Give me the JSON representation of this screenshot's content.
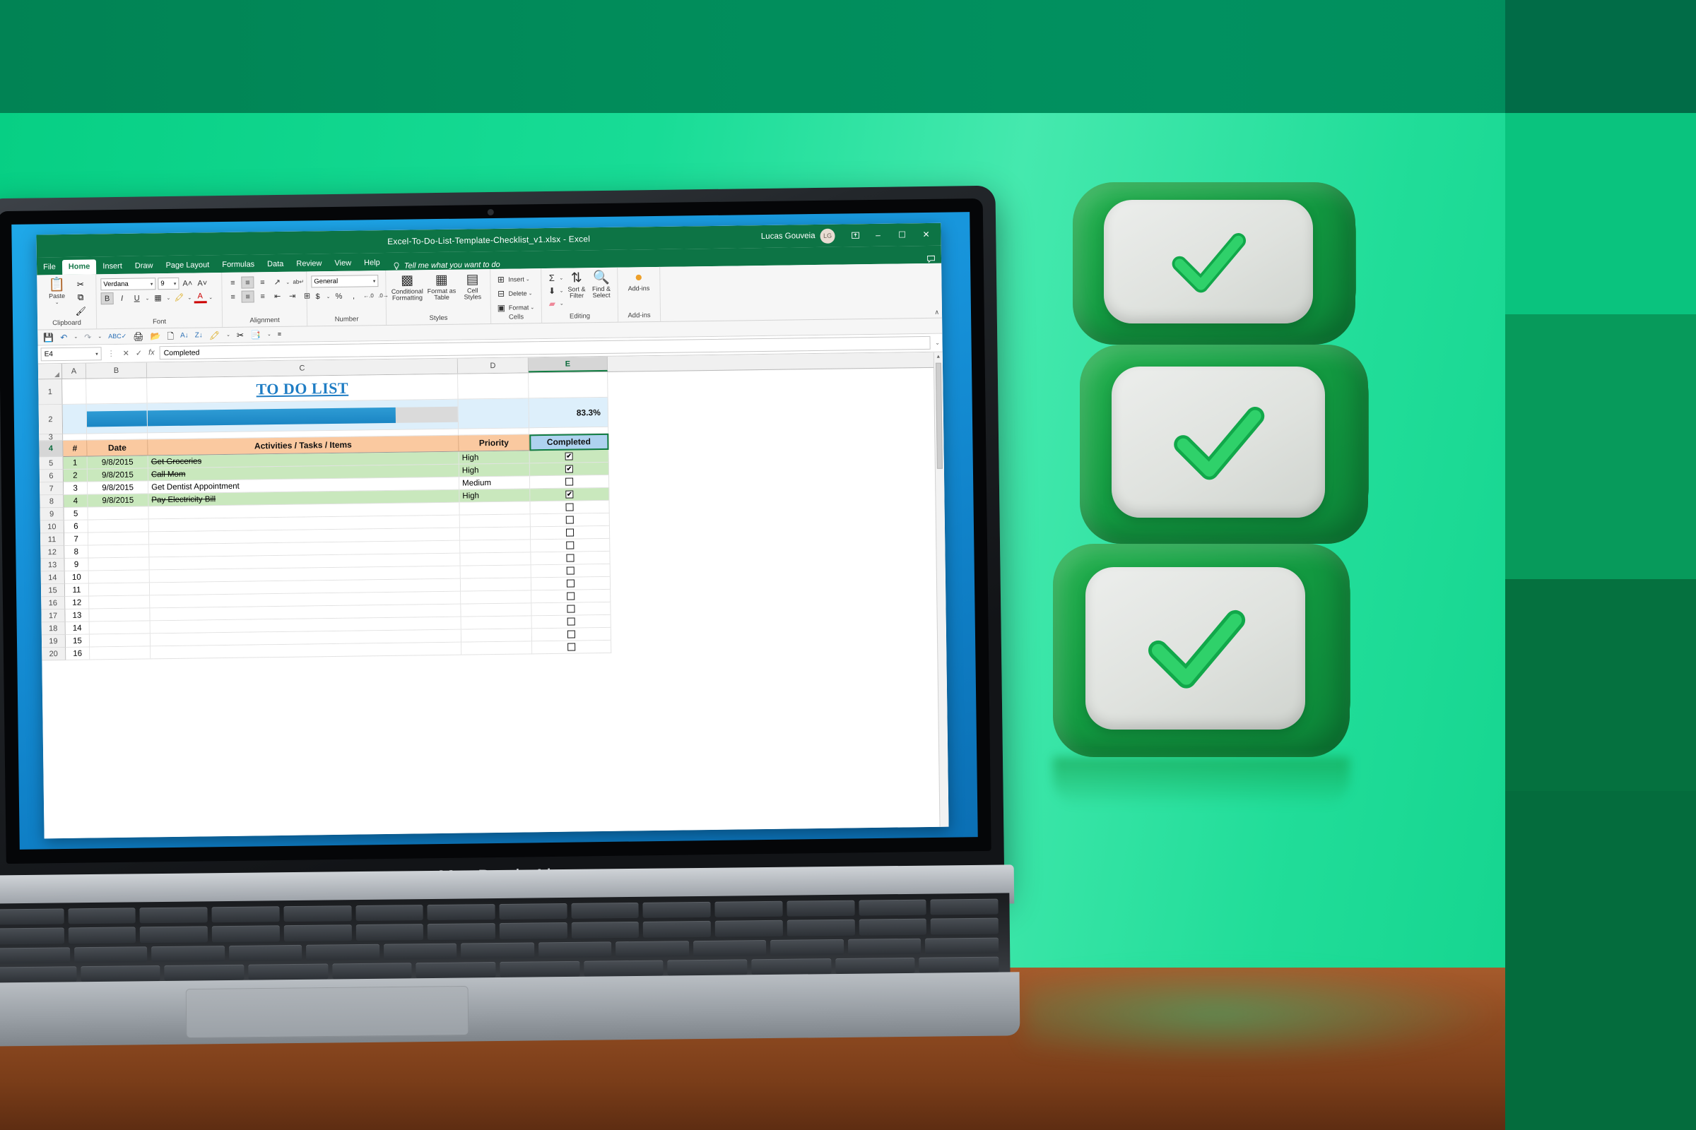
{
  "scene": {
    "laptop_model": "MacBook Air",
    "colors": {
      "brand_green": "#0d7445",
      "bg_top": "#018d5b",
      "bg_main": "#18dc96",
      "accent_blue": "#1f7dc4",
      "header_orange": "#fac9a0",
      "header_blue": "#aed2ef",
      "row_green": "#c9e8bd"
    }
  },
  "excel": {
    "titlebar": {
      "document_title": "Excel-To-Do-List-Template-Checklist_v1.xlsx  -  Excel",
      "account_name": "Lucas Gouveia",
      "account_initials": "LG",
      "ribbon_display_icon": "ribbon-display-options-icon",
      "minimize_label": "–",
      "maximize_label": "☐",
      "close_label": "✕"
    },
    "tabs": [
      {
        "label": "File",
        "active": false
      },
      {
        "label": "Home",
        "active": true
      },
      {
        "label": "Insert",
        "active": false
      },
      {
        "label": "Draw",
        "active": false
      },
      {
        "label": "Page Layout",
        "active": false
      },
      {
        "label": "Formulas",
        "active": false
      },
      {
        "label": "Data",
        "active": false
      },
      {
        "label": "Review",
        "active": false
      },
      {
        "label": "View",
        "active": false
      },
      {
        "label": "Help",
        "active": false
      }
    ],
    "tellme": {
      "placeholder": "Tell me what you want to do",
      "icon": "lightbulb-icon"
    },
    "comments_icon": "comments-icon",
    "ribbon": {
      "clipboard": {
        "label": "Clipboard",
        "paste": "Paste",
        "cut": "Cut",
        "copy": "Copy",
        "format_painter": "Format Painter"
      },
      "font": {
        "label": "Font",
        "font_name": "Verdana",
        "font_size": "9",
        "grow": "A",
        "shrink": "A",
        "bold": "B",
        "italic": "I",
        "underline": "U",
        "borders": "Borders",
        "fill_color": "Fill Color",
        "font_color": "A"
      },
      "alignment": {
        "label": "Alignment",
        "orientation": "Orientation",
        "wrap_text": "Wrap Text",
        "merge": "Merge & Center"
      },
      "number": {
        "label": "Number",
        "format": "General",
        "currency": "$",
        "percent": "%",
        "comma": ",",
        "inc_dec": ".00",
        "dec_dec": ".00"
      },
      "styles": {
        "label": "Styles",
        "conditional_formatting": "Conditional Formatting",
        "format_as_table": "Format as Table",
        "cell_styles": "Cell Styles"
      },
      "cells": {
        "label": "Cells",
        "insert": "Insert",
        "delete": "Delete",
        "format": "Format"
      },
      "editing": {
        "label": "Editing",
        "autosum": "Σ",
        "fill": "Fill",
        "clear": "Clear",
        "sort_filter": "Sort & Filter",
        "find_select": "Find & Select"
      },
      "addins": {
        "label": "Add-ins",
        "button": "Add-ins"
      },
      "collapse": "∧"
    },
    "quick_access": [
      "save-icon",
      "undo-icon",
      "redo-icon",
      "spelling-icon",
      "print-preview-icon",
      "open-icon",
      "new-icon",
      "sort-ascending-icon",
      "sort-descending-icon",
      "fill-color-icon",
      "cut-icon",
      "paste-special-icon",
      "more-icon"
    ],
    "formula_bar": {
      "name_box": "E4",
      "cancel_icon": "✕",
      "enter_icon": "✓",
      "function_icon": "fx",
      "value": "Completed",
      "expand_icon": "⌄"
    },
    "grid": {
      "columns": [
        {
          "id": "A",
          "selected": false
        },
        {
          "id": "B",
          "selected": false
        },
        {
          "id": "C",
          "selected": false
        },
        {
          "id": "D",
          "selected": false
        },
        {
          "id": "E",
          "selected": true
        }
      ],
      "sheet_title": "TO DO LIST",
      "progress": {
        "percent_label": "83.3%",
        "percent_value": 83.3
      },
      "headers": {
        "num": "#",
        "date": "Date",
        "activity": "Activities / Tasks / Items",
        "priority": "Priority",
        "completed": "Completed"
      },
      "selected_cell": "E4",
      "rows": [
        {
          "row": "1",
          "type": "title"
        },
        {
          "row": "2",
          "type": "progress"
        },
        {
          "row": "3",
          "type": "spacer"
        },
        {
          "row": "4",
          "type": "header"
        },
        {
          "row": "5",
          "num": "1",
          "date": "9/8/2015",
          "activity": "Get Groceries",
          "priority": "High",
          "completed": true,
          "done": true
        },
        {
          "row": "6",
          "num": "2",
          "date": "9/8/2015",
          "activity": "Call Mom",
          "priority": "High",
          "completed": true,
          "done": true
        },
        {
          "row": "7",
          "num": "3",
          "date": "9/8/2015",
          "activity": "Get Dentist Appointment",
          "priority": "Medium",
          "completed": false,
          "done": false
        },
        {
          "row": "8",
          "num": "4",
          "date": "9/8/2015",
          "activity": "Pay Electricity Bill",
          "priority": "High",
          "completed": true,
          "done": true
        },
        {
          "row": "9",
          "num": "5",
          "date": "",
          "activity": "",
          "priority": "",
          "completed": false,
          "done": false
        },
        {
          "row": "10",
          "num": "6",
          "date": "",
          "activity": "",
          "priority": "",
          "completed": false,
          "done": false
        },
        {
          "row": "11",
          "num": "7",
          "date": "",
          "activity": "",
          "priority": "",
          "completed": false,
          "done": false
        },
        {
          "row": "12",
          "num": "8",
          "date": "",
          "activity": "",
          "priority": "",
          "completed": false,
          "done": false
        },
        {
          "row": "13",
          "num": "9",
          "date": "",
          "activity": "",
          "priority": "",
          "completed": false,
          "done": false
        },
        {
          "row": "14",
          "num": "10",
          "date": "",
          "activity": "",
          "priority": "",
          "completed": false,
          "done": false
        },
        {
          "row": "15",
          "num": "11",
          "date": "",
          "activity": "",
          "priority": "",
          "completed": false,
          "done": false
        },
        {
          "row": "16",
          "num": "12",
          "date": "",
          "activity": "",
          "priority": "",
          "completed": false,
          "done": false
        },
        {
          "row": "17",
          "num": "13",
          "date": "",
          "activity": "",
          "priority": "",
          "completed": false,
          "done": false
        },
        {
          "row": "18",
          "num": "14",
          "date": "",
          "activity": "",
          "priority": "",
          "completed": false,
          "done": false
        },
        {
          "row": "19",
          "num": "15",
          "date": "",
          "activity": "",
          "priority": "",
          "completed": false,
          "done": false
        },
        {
          "row": "20",
          "num": "16",
          "date": "",
          "activity": "",
          "priority": "",
          "completed": false,
          "done": false
        }
      ],
      "checkbox_checked_glyph": "✔",
      "scroll_up_icon": "▲",
      "scroll_down_icon": "▼"
    }
  },
  "decor": {
    "check_cubes": [
      {
        "name": "check-cube-top"
      },
      {
        "name": "check-cube-middle"
      },
      {
        "name": "check-cube-bottom"
      }
    ]
  }
}
